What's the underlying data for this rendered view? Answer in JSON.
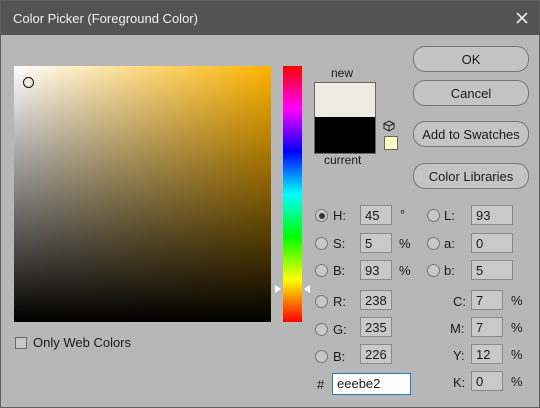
{
  "window": {
    "title": "Color Picker (Foreground Color)"
  },
  "swatch": {
    "new_label": "new",
    "current_label": "current",
    "new_color": "#eeebe2",
    "current_color": "#000000"
  },
  "buttons": {
    "ok": "OK",
    "cancel": "Cancel",
    "add_to_swatches": "Add to Swatches",
    "color_libraries": "Color Libraries"
  },
  "only_web_colors": "Only Web Colors",
  "fields": {
    "H": {
      "label": "H:",
      "value": "45",
      "unit": "°"
    },
    "S": {
      "label": "S:",
      "value": "5",
      "unit": "%"
    },
    "Bv": {
      "label": "B:",
      "value": "93",
      "unit": "%"
    },
    "R": {
      "label": "R:",
      "value": "238"
    },
    "G": {
      "label": "G:",
      "value": "235"
    },
    "B": {
      "label": "B:",
      "value": "226"
    },
    "L": {
      "label": "L:",
      "value": "93"
    },
    "a": {
      "label": "a:",
      "value": "0"
    },
    "b": {
      "label": "b:",
      "value": "5"
    },
    "C": {
      "label": "C:",
      "value": "7",
      "unit": "%"
    },
    "M": {
      "label": "M:",
      "value": "7",
      "unit": "%"
    },
    "Y": {
      "label": "Y:",
      "value": "12",
      "unit": "%"
    },
    "K": {
      "label": "K:",
      "value": "0",
      "unit": "%"
    }
  },
  "hex": {
    "label": "#",
    "value": "eeebe2"
  },
  "icons": {
    "close": "close-icon",
    "cube": "cube-warning-icon"
  }
}
